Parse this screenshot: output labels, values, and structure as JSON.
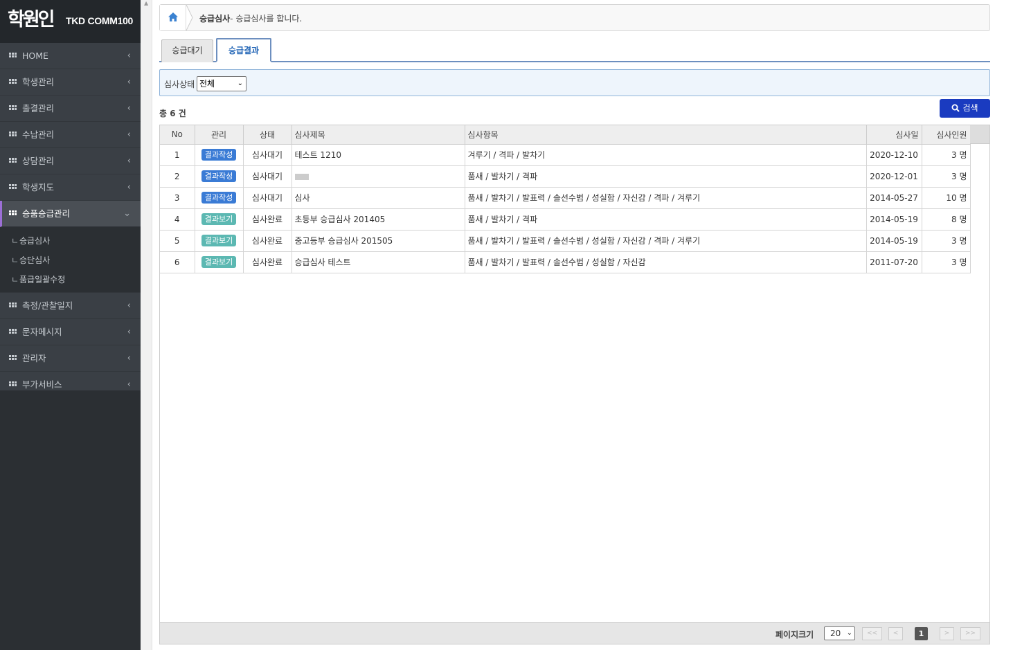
{
  "app": {
    "logo_text": "학원인",
    "brand": "TKD COMM100"
  },
  "sidebar": {
    "items": [
      {
        "label": "HOME"
      },
      {
        "label": "학생관리"
      },
      {
        "label": "출결관리"
      },
      {
        "label": "수납관리"
      },
      {
        "label": "상담관리"
      },
      {
        "label": "학생지도"
      },
      {
        "label": "승품승급관리",
        "expanded": true
      },
      {
        "label": "측정/관찰일지"
      },
      {
        "label": "문자메시지"
      },
      {
        "label": "관리자"
      },
      {
        "label": "부가서비스"
      }
    ],
    "submenu": [
      "승급심사",
      "승단심사",
      "품급일괄수정"
    ],
    "accent": "#9c6fd6"
  },
  "breadcrumb": {
    "title": "승급심사",
    "desc": "- 승급심사를 합니다."
  },
  "tabs": [
    {
      "label": "승급대기"
    },
    {
      "label": "승급결과",
      "active": true
    }
  ],
  "filter": {
    "label": "심사상태",
    "value": "전체"
  },
  "total_text": "총 6 건",
  "search_button": "검색",
  "table": {
    "headers": [
      "No",
      "관리",
      "상태",
      "심사제목",
      "심사항목",
      "심사일",
      "심사인원"
    ],
    "rows": [
      {
        "no": "1",
        "action": "결과작성",
        "status": "심사대기",
        "title": "테스트 1210",
        "items": "겨루기 / 격파 / 발차기",
        "date": "2020-12-10",
        "count": "3 명"
      },
      {
        "no": "2",
        "action": "결과작성",
        "status": "심사대기",
        "title": "",
        "items": "품새 / 발차기 / 격파",
        "date": "2020-12-01",
        "count": "3 명"
      },
      {
        "no": "3",
        "action": "결과작성",
        "status": "심사대기",
        "title": "심사",
        "items": "품새 / 발차기 / 발표력 / 솔선수범 / 성실함 / 자신감 / 격파 / 겨루기",
        "date": "2014-05-27",
        "count": "10 명"
      },
      {
        "no": "4",
        "action": "결과보기",
        "status": "심사완료",
        "title": "초등부 승급심사 201405",
        "items": "품새 / 발차기 / 격파",
        "date": "2014-05-19",
        "count": "8 명"
      },
      {
        "no": "5",
        "action": "결과보기",
        "status": "심사완료",
        "title": "중고등부 승급심사 201505",
        "items": "품새 / 발차기 / 발표력 / 솔선수범 / 성실함 / 자신감 / 격파 / 겨루기",
        "date": "2014-05-19",
        "count": "3 명"
      },
      {
        "no": "6",
        "action": "결과보기",
        "status": "심사완료",
        "title": "승급심사 테스트",
        "items": "품새 / 발차기 / 발표력 / 솔선수범 / 성실함 / 자신감",
        "date": "2011-07-20",
        "count": "3 명"
      }
    ]
  },
  "pager": {
    "page_size_label": "페이지크기",
    "page_size": "20",
    "first": "<<",
    "prev": "<",
    "next": ">",
    "last": ">>",
    "current_page": "1"
  },
  "colors": {
    "badge_write": "#3a7bd5",
    "badge_view": "#5cb8b2",
    "search_button": "#1a3bc0"
  }
}
